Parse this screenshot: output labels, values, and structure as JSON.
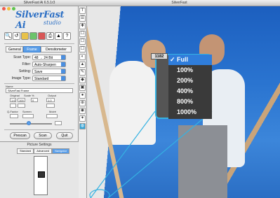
{
  "left_window": {
    "title": "SilverFast Ai 6.5.1r3",
    "logo_text": "SilverFast Ai",
    "logo_sub": "studio",
    "tools": [
      "scan-icon",
      "reset-icon",
      "hsl-icon",
      "color-icon",
      "gradation-icon",
      "print-icon",
      "sharpen-icon",
      "help-icon"
    ],
    "tabs": [
      {
        "label": "General",
        "active": false
      },
      {
        "label": "Frame",
        "active": true
      },
      {
        "label": "Densitometer",
        "active": false
      }
    ],
    "params": [
      {
        "label": "Scan Type:",
        "value": "48 → 24 Bit"
      },
      {
        "label": "Filter:",
        "value": "Auto-Sharpen"
      },
      {
        "label": "Setting:",
        "value": "Save"
      },
      {
        "label": "Image Type:",
        "value": "Standard"
      }
    ],
    "name_head": "Name",
    "name_value": "SilverFast Frame",
    "dims_labels": {
      "original": "Original",
      "scale": "Scale %",
      "output": "Output",
      "qfactor": "Q-Factor",
      "screen": "Screen",
      "moire": "Moiré"
    },
    "dims_values": {
      "w1": "1.6",
      "h1": "100",
      "w2": "0",
      "h2": "1.0"
    },
    "buttons": {
      "prescan": "Prescan",
      "scan": "Scan",
      "quit": "Quit"
    },
    "picture_settings_title": "Picture Settings",
    "picture_tabs": [
      {
        "label": "Standard",
        "active": false
      },
      {
        "label": "Advanced",
        "active": false
      },
      {
        "label": "Navigator",
        "active": true
      }
    ]
  },
  "right_window": {
    "title": "SilverFast",
    "magnifier_number": "1182",
    "zoom_menu": [
      {
        "label": "Full",
        "selected": true
      },
      {
        "label": "100%",
        "selected": false
      },
      {
        "label": "200%",
        "selected": false
      },
      {
        "label": "400%",
        "selected": false
      },
      {
        "label": "800%",
        "selected": false
      },
      {
        "label": "1000%",
        "selected": false
      }
    ],
    "check_glyph": "✓",
    "vtools": [
      "T",
      "☰",
      "✚",
      "☐",
      "☐",
      "☐",
      "◐",
      "▲",
      "✎",
      "◆",
      "▣",
      "●",
      "⊕",
      "◉",
      "✦",
      "◍"
    ]
  },
  "colors": {
    "accent": "#2f7ddb",
    "loupe_border": "#35b2e2",
    "logo": "#2c6fc4"
  }
}
